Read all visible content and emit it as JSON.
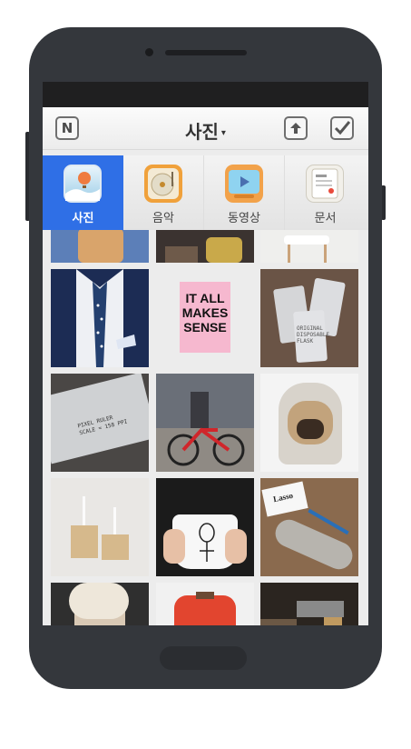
{
  "app": {
    "title": "사진",
    "title_caret": "▾",
    "logo_letter": "N"
  },
  "header": {
    "left_icon": "naver-n-icon",
    "upload_icon": "upload-icon",
    "check_icon": "checkbox-icon"
  },
  "tabs": [
    {
      "label": "사진",
      "icon": "photo-balloon-icon",
      "active": true
    },
    {
      "label": "음악",
      "icon": "music-turntable-icon",
      "active": false
    },
    {
      "label": "동영상",
      "icon": "video-tv-icon",
      "active": false
    },
    {
      "label": "문서",
      "icon": "document-icon",
      "active": false
    }
  ],
  "photos": {
    "poster_lines": [
      "IT ALL",
      "MAKES",
      "SENSE"
    ],
    "ruler_lines": [
      "PIXEL RULER",
      "SCALE = 158 PPI"
    ],
    "bag_lines": [
      "ORIGINAL",
      "DISPOSABLE",
      "FLASK"
    ],
    "card_logo": "Lasso"
  },
  "colors": {
    "accent_tab": "#2f6fe6",
    "phone_body": "#34373c"
  }
}
